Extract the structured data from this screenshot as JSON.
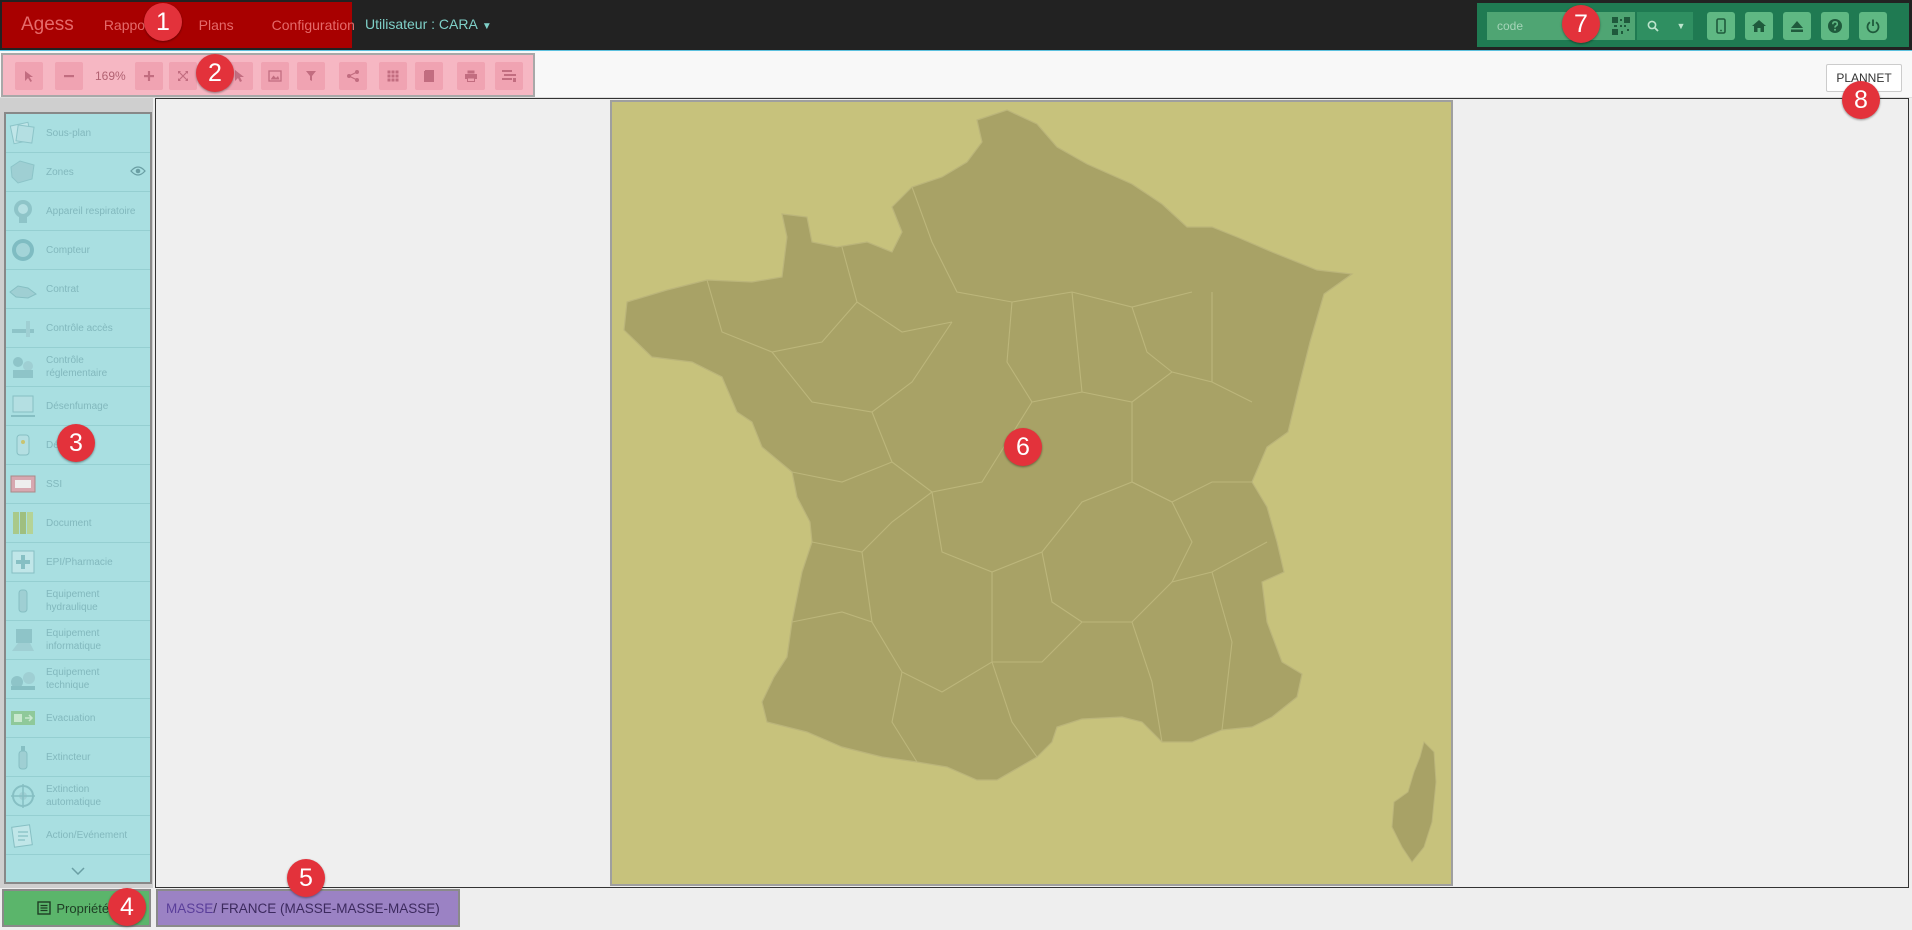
{
  "navbar": {
    "brand": "Agess",
    "links": [
      "Rapports",
      "Plans",
      "Configuration"
    ],
    "user_label": "Utilisateur : CARA",
    "code_placeholder": "code"
  },
  "toolbar": {
    "zoom_level": "169%",
    "plannet_label": "PLANNET"
  },
  "sidebar": {
    "items": [
      {
        "label": "Sous-plan",
        "icon": "subplan-icon"
      },
      {
        "label": "Zones",
        "icon": "zones-icon"
      },
      {
        "label": "Appareil respiratoire",
        "icon": "respirator-icon"
      },
      {
        "label": "Compteur",
        "icon": "meter-icon"
      },
      {
        "label": "Contrat",
        "icon": "contract-icon"
      },
      {
        "label": "Contrôle accès",
        "icon": "access-control-icon"
      },
      {
        "label": "Contrôle réglementaire",
        "icon": "regulatory-control-icon"
      },
      {
        "label": "Désenfumage",
        "icon": "smoke-extraction-icon"
      },
      {
        "label": "Détecteurs",
        "icon": "detector-icon"
      },
      {
        "label": "SSI",
        "icon": "ssi-icon"
      },
      {
        "label": "Document",
        "icon": "document-icon"
      },
      {
        "label": "EPI/Pharmacie",
        "icon": "pharmacy-icon"
      },
      {
        "label": "Equipement hydraulique",
        "icon": "hydraulic-icon"
      },
      {
        "label": "Equipement informatique",
        "icon": "computer-icon"
      },
      {
        "label": "Equipement technique",
        "icon": "technical-icon"
      },
      {
        "label": "Evacuation",
        "icon": "evacuation-icon"
      },
      {
        "label": "Extincteur",
        "icon": "extinguisher-icon"
      },
      {
        "label": "Extinction automatique",
        "icon": "auto-extinction-icon"
      },
      {
        "label": "Action/Evénement",
        "icon": "action-event-icon"
      }
    ]
  },
  "properties_label": "Propriétés",
  "breadcrumb": {
    "link": "MASSE",
    "rest": " / FRANCE (MASSE-MASSE-MASSE)"
  },
  "markers": [
    "1",
    "2",
    "3",
    "4",
    "5",
    "6",
    "7",
    "8"
  ],
  "colors": {
    "navbar_bg": "#222222",
    "nav_left_highlight": "#a80000",
    "nav_right_highlight": "#1f7a52",
    "toolbar_highlight": "#f6b7c3",
    "sidebar_highlight": "#a9dfe1",
    "properties_highlight": "#5bb56b",
    "breadcrumb_highlight": "#9b82c4",
    "map_bg": "#c7c27c",
    "map_land": "#a8a266",
    "marker": "#e3323b"
  }
}
